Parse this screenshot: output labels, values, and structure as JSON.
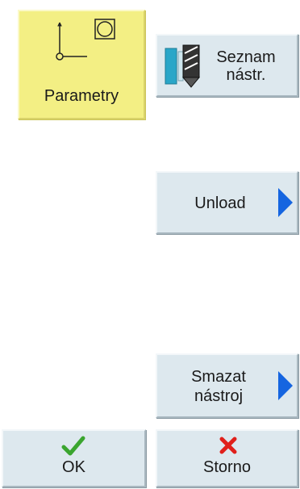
{
  "softkeys": {
    "parametry": {
      "label": "Parametry",
      "icon": "axis-work-offset-icon"
    },
    "seznam": {
      "label_line1": "Seznam",
      "label_line2": "nástr.",
      "icon": "tool-list-icon"
    },
    "unload": {
      "label": "Unload",
      "icon": "arrow-right-icon"
    },
    "smazat": {
      "label_line1": "Smazat",
      "label_line2": "nástroj",
      "icon": "arrow-right-icon"
    },
    "ok": {
      "label": "OK",
      "icon": "checkmark-icon"
    },
    "storno": {
      "label": "Storno",
      "icon": "cross-icon"
    }
  },
  "colors": {
    "button_bg": "#dde8ee",
    "active_bg": "#f3ef84",
    "arrow": "#1565e0",
    "ok_green": "#3aa52f",
    "cancel_red": "#e0201b"
  }
}
